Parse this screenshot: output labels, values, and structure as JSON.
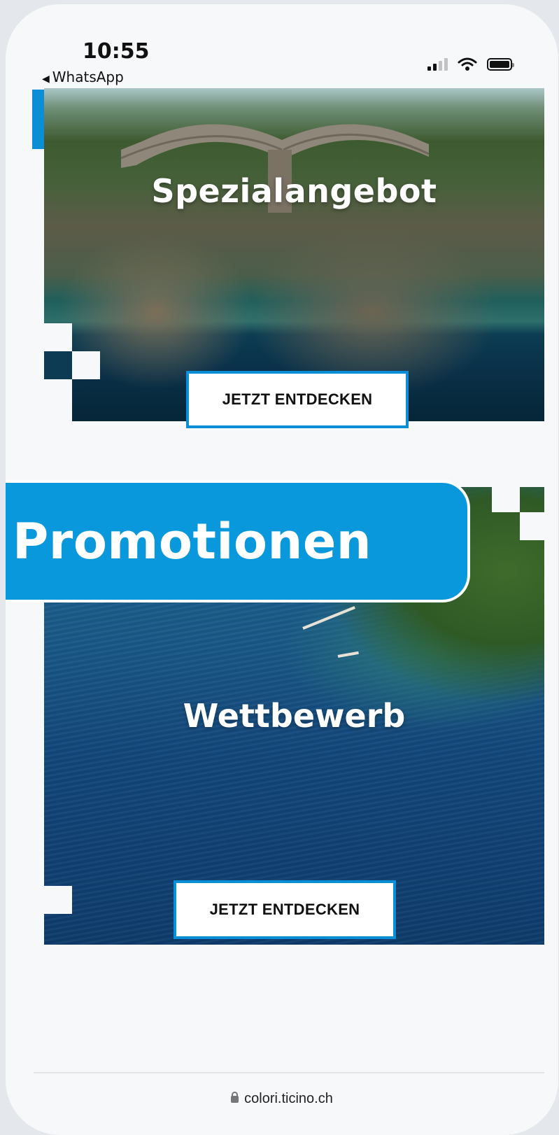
{
  "status_bar": {
    "time": "10:55",
    "back_label": "WhatsApp",
    "back_icon": "back-triangle-icon"
  },
  "promos": [
    {
      "title": "Spezialangebot",
      "cta_label": "JETZT ENTDECKEN"
    },
    {
      "title": "Wettbewerb",
      "cta_label": "JETZT ENTDECKEN"
    }
  ],
  "banner": {
    "label": "Promotionen"
  },
  "url_bar": {
    "domain": "colori.ticino.ch"
  },
  "colors": {
    "accent": "#0a98dc",
    "cta_border": "#0a8fd6",
    "background": "#e4e8ec"
  }
}
